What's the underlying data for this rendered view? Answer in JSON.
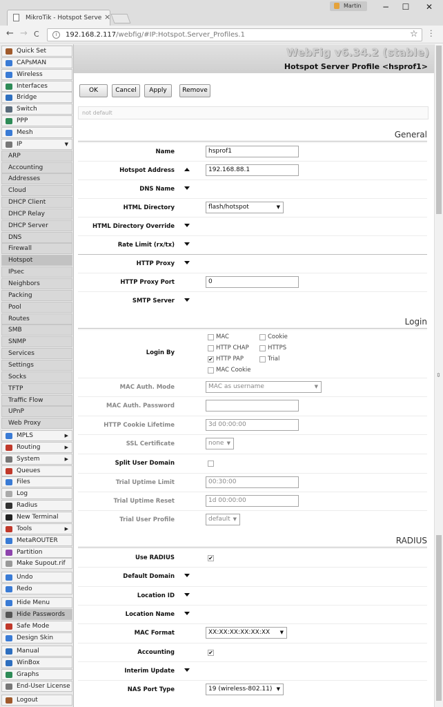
{
  "browser": {
    "tab_title": "MikroTik - Hotspot Serve",
    "tab_close": "×",
    "user_name": "Martin",
    "url_host": "192.168.2.117",
    "url_path": "/webfig/#IP:Hotspot.Server_Profiles.1",
    "window_controls": [
      "−",
      "☐",
      "✕"
    ],
    "back_icon": "←",
    "forward_icon": "→",
    "reload_icon": "C",
    "star_icon": "☆"
  },
  "sidebar": {
    "items": [
      {
        "label": "Quick Set",
        "icon": "quickset-icon",
        "color": "#a05a2c"
      },
      {
        "label": "CAPsMAN",
        "icon": "capsman-icon",
        "color": "#3a7bd5"
      },
      {
        "label": "Wireless",
        "icon": "wireless-icon",
        "color": "#3a7bd5"
      },
      {
        "label": "Interfaces",
        "icon": "interfaces-icon",
        "color": "#2e8b57"
      },
      {
        "label": "Bridge",
        "icon": "bridge-icon",
        "color": "#2e6fbf"
      },
      {
        "label": "Switch",
        "icon": "switch-icon",
        "color": "#5a6b7a"
      },
      {
        "label": "PPP",
        "icon": "ppp-icon",
        "color": "#2e8b57"
      },
      {
        "label": "Mesh",
        "icon": "mesh-icon",
        "color": "#3a7bd5"
      },
      {
        "label": "IP",
        "icon": "ip-icon",
        "color": "#777777",
        "arrow": "▼"
      },
      {
        "label": "ARP",
        "sub": true
      },
      {
        "label": "Accounting",
        "sub": true
      },
      {
        "label": "Addresses",
        "sub": true
      },
      {
        "label": "Cloud",
        "sub": true
      },
      {
        "label": "DHCP Client",
        "sub": true
      },
      {
        "label": "DHCP Relay",
        "sub": true
      },
      {
        "label": "DHCP Server",
        "sub": true
      },
      {
        "label": "DNS",
        "sub": true
      },
      {
        "label": "Firewall",
        "sub": true
      },
      {
        "label": "Hotspot",
        "sub": true,
        "active": true
      },
      {
        "label": "IPsec",
        "sub": true
      },
      {
        "label": "Neighbors",
        "sub": true
      },
      {
        "label": "Packing",
        "sub": true
      },
      {
        "label": "Pool",
        "sub": true
      },
      {
        "label": "Routes",
        "sub": true
      },
      {
        "label": "SMB",
        "sub": true
      },
      {
        "label": "SNMP",
        "sub": true
      },
      {
        "label": "Services",
        "sub": true
      },
      {
        "label": "Settings",
        "sub": true
      },
      {
        "label": "Socks",
        "sub": true
      },
      {
        "label": "TFTP",
        "sub": true
      },
      {
        "label": "Traffic Flow",
        "sub": true
      },
      {
        "label": "UPnP",
        "sub": true
      },
      {
        "label": "Web Proxy",
        "sub": true
      },
      {
        "label": "MPLS",
        "icon": "mpls-icon",
        "color": "#3a7bd5",
        "arrow": "▶"
      },
      {
        "label": "Routing",
        "icon": "routing-icon",
        "color": "#c0392b",
        "arrow": "▶"
      },
      {
        "label": "System",
        "icon": "system-icon",
        "color": "#777777",
        "arrow": "▶"
      },
      {
        "label": "Queues",
        "icon": "queues-icon",
        "color": "#c0392b"
      },
      {
        "label": "Files",
        "icon": "files-icon",
        "color": "#3a7bd5"
      },
      {
        "label": "Log",
        "icon": "log-icon",
        "color": "#aaaaaa"
      },
      {
        "label": "Radius",
        "icon": "radius-icon",
        "color": "#333333"
      },
      {
        "label": "New Terminal",
        "icon": "terminal-icon",
        "color": "#222222"
      },
      {
        "label": "Tools",
        "icon": "tools-icon",
        "color": "#c0392b",
        "arrow": "▶"
      },
      {
        "label": "MetaROUTER",
        "icon": "metarouter-icon",
        "color": "#3a7bd5"
      },
      {
        "label": "Partition",
        "icon": "partition-icon",
        "color": "#8e44ad"
      },
      {
        "label": "Make Supout.rif",
        "icon": "supout-icon",
        "color": "#999999"
      },
      {
        "label": "Undo",
        "icon": "undo-icon",
        "color": "#3a7bd5"
      },
      {
        "label": "Redo",
        "icon": "redo-icon",
        "color": "#3a7bd5"
      },
      {
        "label": "Hide Menu",
        "icon": "hide-menu-icon",
        "color": "#3a7bd5"
      },
      {
        "label": "Hide Passwords",
        "icon": "hide-passwords-icon",
        "color": "#555555",
        "active": true
      },
      {
        "label": "Safe Mode",
        "icon": "safe-mode-icon",
        "color": "#c0392b"
      },
      {
        "label": "Design Skin",
        "icon": "design-skin-icon",
        "color": "#3a7bd5"
      },
      {
        "label": "Manual",
        "icon": "manual-icon",
        "color": "#2e6fbf"
      },
      {
        "label": "WinBox",
        "icon": "winbox-icon",
        "color": "#2e6fbf"
      },
      {
        "label": "Graphs",
        "icon": "graphs-icon",
        "color": "#2e8b57"
      },
      {
        "label": "End-User License",
        "icon": "license-icon",
        "color": "#777777"
      },
      {
        "label": "Logout",
        "icon": "logout-icon",
        "color": "#a05a2c"
      }
    ]
  },
  "header": {
    "version": "WebFig v6.34.2 (stable)",
    "title": "Hotspot Server Profile <hsprof1>"
  },
  "toolbar": {
    "ok": "OK",
    "cancel": "Cancel",
    "apply": "Apply",
    "remove": "Remove"
  },
  "status": "not default",
  "general": {
    "section": "General",
    "name_label": "Name",
    "name_value": "hsprof1",
    "hotspot_address_label": "Hotspot Address",
    "hotspot_address_value": "192.168.88.1",
    "dns_name_label": "DNS Name",
    "html_directory_label": "HTML Directory",
    "html_directory_value": "flash/hotspot",
    "html_directory_override_label": "HTML Directory Override",
    "rate_limit_label": "Rate Limit (rx/tx)",
    "http_proxy_label": "HTTP Proxy",
    "http_proxy_port_label": "HTTP Proxy Port",
    "http_proxy_port_value": "0",
    "smtp_server_label": "SMTP Server"
  },
  "login": {
    "section": "Login",
    "login_by_label": "Login By",
    "options": [
      {
        "label": "MAC",
        "checked": false
      },
      {
        "label": "Cookie",
        "checked": false
      },
      {
        "label": "HTTP CHAP",
        "checked": false
      },
      {
        "label": "HTTPS",
        "checked": false
      },
      {
        "label": "HTTP PAP",
        "checked": true
      },
      {
        "label": "Trial",
        "checked": false
      },
      {
        "label": "MAC Cookie",
        "checked": false
      }
    ],
    "mac_auth_mode_label": "MAC Auth. Mode",
    "mac_auth_mode_value": "MAC as username",
    "mac_auth_password_label": "MAC Auth. Password",
    "mac_auth_password_value": "",
    "http_cookie_lifetime_label": "HTTP Cookie Lifetime",
    "http_cookie_lifetime_value": "3d 00:00:00",
    "ssl_certificate_label": "SSL Certificate",
    "ssl_certificate_value": "none",
    "split_user_domain_label": "Split User Domain",
    "trial_uptime_limit_label": "Trial Uptime Limit",
    "trial_uptime_limit_value": "00:30:00",
    "trial_uptime_reset_label": "Trial Uptime Reset",
    "trial_uptime_reset_value": "1d 00:00:00",
    "trial_user_profile_label": "Trial User Profile",
    "trial_user_profile_value": "default"
  },
  "radius": {
    "section": "RADIUS",
    "use_radius_label": "Use RADIUS",
    "use_radius_checked": true,
    "default_domain_label": "Default Domain",
    "location_id_label": "Location ID",
    "location_name_label": "Location Name",
    "mac_format_label": "MAC Format",
    "mac_format_value": "XX:XX:XX:XX:XX:XX",
    "accounting_label": "Accounting",
    "accounting_checked": true,
    "interim_update_label": "Interim Update",
    "nas_port_type_label": "NAS Port Type",
    "nas_port_type_value": "19 (wireless-802.11)"
  },
  "glyphs": {
    "check": "✔",
    "caret": "▼"
  }
}
